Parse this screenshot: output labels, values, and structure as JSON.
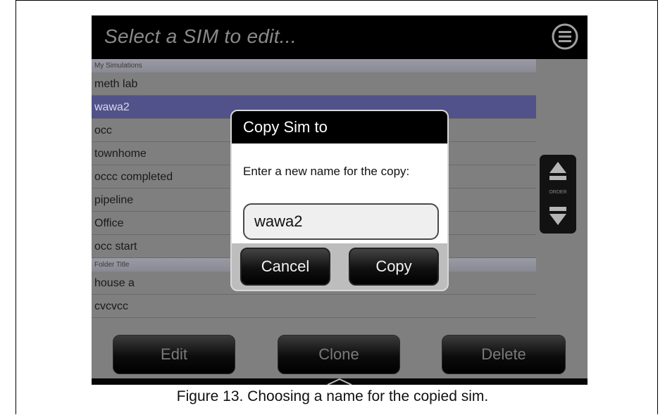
{
  "header": {
    "title": "Select a SIM to edit..."
  },
  "sections": [
    {
      "header": "My Simulations",
      "items": [
        "meth lab",
        "wawa2",
        "occ",
        "townhome",
        "occc completed",
        "pipeline",
        "Office",
        "occ start"
      ]
    },
    {
      "header": "Folder Title",
      "items": [
        "house a",
        "cvcvcc"
      ]
    }
  ],
  "selected_item": "wawa2",
  "order_label": "ORDER",
  "bottom_buttons": {
    "edit": "Edit",
    "clone": "Clone",
    "delete": "Delete"
  },
  "dialog": {
    "title": "Copy Sim to",
    "message": "Enter a new name for the copy:",
    "input_value": "wawa2",
    "cancel": "Cancel",
    "copy": "Copy"
  },
  "caption": "Figure 13. Choosing a name for the copied sim.",
  "colors": {
    "selected_row": "#52528a",
    "screen_bg": "#7f7f7f",
    "bar": "#000000"
  }
}
